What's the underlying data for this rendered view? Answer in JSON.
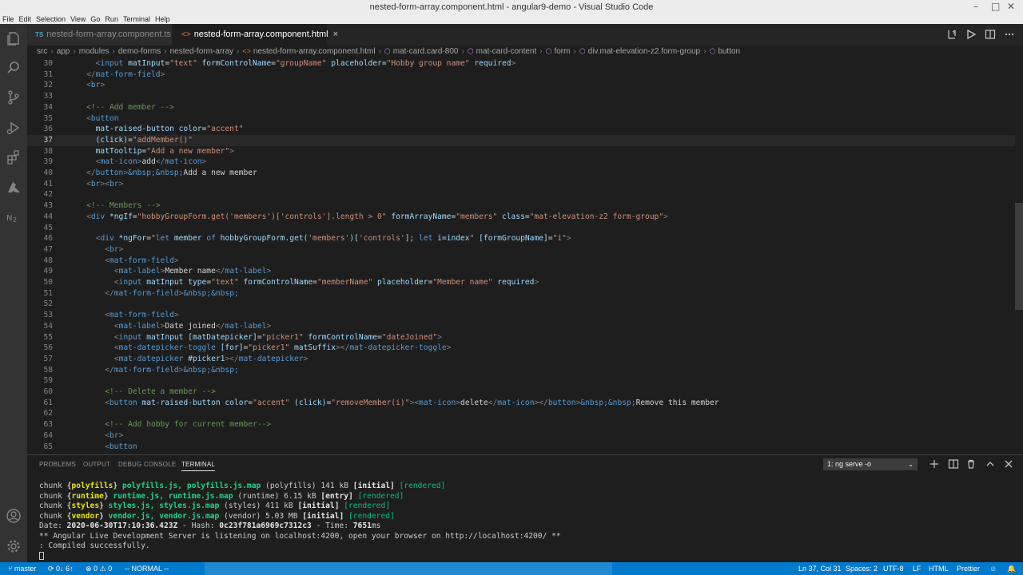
{
  "window": {
    "title": "nested-form-array.component.html - angular9-demo - Visual Studio Code"
  },
  "menu": [
    "File",
    "Edit",
    "Selection",
    "View",
    "Go",
    "Run",
    "Terminal",
    "Help"
  ],
  "tabs": [
    {
      "badge": "TS",
      "label": "nested-form-array.component.ts"
    },
    {
      "badge": "<>",
      "label": "nested-form-array.component.html",
      "close": "×"
    }
  ],
  "breadcrumb": [
    "src",
    "app",
    "modules",
    "demo-forms",
    "nested-form-array",
    "nested-form-array.component.html",
    "mat-card.card-800",
    "mat-card-content",
    "form",
    "div.mat-elevation-z2.form-group",
    "button"
  ],
  "editor": {
    "lines": [
      {
        "n": "30",
        "t": [
          [
            "      ",
            ""
          ],
          [
            "<",
            "tb"
          ],
          [
            "input",
            "tag"
          ],
          [
            " matInput",
            "attr"
          ],
          [
            "=",
            "txt"
          ],
          [
            "\"text\"",
            "str"
          ]
        ]
      },
      {
        "n": "31",
        "t": [
          [
            "    ",
            ""
          ],
          [
            "</",
            "tb"
          ],
          [
            "mat-form-field",
            "tag"
          ],
          [
            ">",
            "tb"
          ]
        ]
      },
      {
        "n": "32",
        "t": [
          [
            "    ",
            ""
          ],
          [
            "<",
            "tb"
          ],
          [
            "br",
            "tag"
          ],
          [
            ">",
            "tb"
          ]
        ]
      },
      {
        "n": "33",
        "t": []
      },
      {
        "n": "34",
        "t": [
          [
            "    ",
            ""
          ],
          [
            "<!-- Add member -->",
            "cmt"
          ]
        ]
      },
      {
        "n": "35",
        "t": [
          [
            "    ",
            ""
          ],
          [
            "<",
            "tb"
          ],
          [
            "button",
            "tag"
          ]
        ]
      },
      {
        "n": "36",
        "t": [
          [
            "      ",
            ""
          ],
          [
            "mat-raised-button",
            "attr"
          ],
          [
            " color",
            "attr"
          ],
          [
            "=",
            "txt"
          ],
          [
            "\"accent\"",
            "str"
          ]
        ]
      },
      {
        "n": "37",
        "t": [
          [
            "      ",
            ""
          ],
          [
            "(click)",
            "attr"
          ],
          [
            "=",
            "txt"
          ],
          [
            "\"addMember()\"",
            "str"
          ]
        ],
        "cur": true
      },
      {
        "n": "38",
        "t": [
          [
            "      ",
            ""
          ],
          [
            "matTooltip",
            "attr"
          ],
          [
            "=",
            "txt"
          ],
          [
            "\"Add a new member\"",
            "str"
          ],
          [
            ">",
            "tb"
          ]
        ]
      },
      {
        "n": "39",
        "t": [
          [
            "      ",
            ""
          ],
          [
            "<",
            "tb"
          ],
          [
            "mat-icon",
            "tag"
          ],
          [
            ">",
            "tb"
          ],
          [
            "add",
            "txt"
          ],
          [
            "</",
            "tb"
          ],
          [
            "mat-icon",
            "tag"
          ],
          [
            ">",
            "tb"
          ]
        ]
      },
      {
        "n": "40",
        "t": [
          [
            "    ",
            ""
          ],
          [
            "</",
            "tb"
          ],
          [
            "button",
            "tag"
          ],
          [
            ">",
            "tb"
          ],
          [
            "&nbsp;&nbsp;",
            "ent"
          ],
          [
            "Add a new member",
            "txt"
          ]
        ]
      },
      {
        "n": "41",
        "t": [
          [
            "    ",
            ""
          ],
          [
            "<",
            "tb"
          ],
          [
            "br",
            "tag"
          ],
          [
            "><",
            "tb"
          ],
          [
            "br",
            "tag"
          ],
          [
            ">",
            "tb"
          ]
        ]
      },
      {
        "n": "42",
        "t": []
      },
      {
        "n": "43",
        "t": [
          [
            "    ",
            ""
          ],
          [
            "<!-- Members -->",
            "cmt"
          ]
        ]
      },
      {
        "n": "44",
        "t": [
          [
            "    ",
            ""
          ],
          [
            "<",
            "tb"
          ],
          [
            "div",
            "tag"
          ],
          [
            " *ngIf",
            "attr"
          ],
          [
            "=",
            "txt"
          ],
          [
            "\"hobbyGroupForm.get('members')['controls'].length > 0\"",
            "str"
          ],
          [
            " formArrayName",
            "attr"
          ],
          [
            "=",
            "txt"
          ],
          [
            "\"members\"",
            "str"
          ],
          [
            " class",
            "attr"
          ],
          [
            "=",
            "txt"
          ],
          [
            "\"mat-elevation-z2 form-group\"",
            "str"
          ],
          [
            ">",
            "tb"
          ]
        ]
      },
      {
        "n": "45",
        "t": []
      },
      {
        "n": "46",
        "t": [
          [
            "      ",
            ""
          ],
          [
            "<",
            "tb"
          ],
          [
            "div",
            "tag"
          ],
          [
            " *ngFor",
            "attr"
          ],
          [
            "=",
            "txt"
          ],
          [
            "\"",
            "str"
          ],
          [
            "let",
            "kw"
          ],
          [
            " member ",
            "attr"
          ],
          [
            "of",
            "kw"
          ],
          [
            " hobbyGroupForm.get(",
            "attr"
          ],
          [
            "'members'",
            "str"
          ],
          [
            ")[",
            "attr"
          ],
          [
            "'controls'",
            "str"
          ],
          [
            "]; ",
            "attr"
          ],
          [
            "let",
            "kw"
          ],
          [
            " i=",
            "attr"
          ],
          [
            "index",
            "attr"
          ],
          [
            "\"",
            "str"
          ],
          [
            " [formGroupName]",
            "attr"
          ],
          [
            "=",
            "txt"
          ],
          [
            "\"i\"",
            "str"
          ],
          [
            ">",
            "tb"
          ]
        ]
      },
      {
        "n": "47",
        "t": [
          [
            "        ",
            ""
          ],
          [
            "<",
            "tb"
          ],
          [
            "br",
            "tag"
          ],
          [
            ">",
            "tb"
          ]
        ]
      },
      {
        "n": "48",
        "t": [
          [
            "        ",
            ""
          ],
          [
            "<",
            "tb"
          ],
          [
            "mat-form-field",
            "tag"
          ],
          [
            ">",
            "tb"
          ]
        ]
      },
      {
        "n": "49",
        "t": [
          [
            "          ",
            ""
          ],
          [
            "<",
            "tb"
          ],
          [
            "mat-label",
            "tag"
          ],
          [
            ">",
            "tb"
          ],
          [
            "Member name",
            "txt"
          ],
          [
            "</",
            "tb"
          ],
          [
            "mat-label",
            "tag"
          ],
          [
            ">",
            "tb"
          ]
        ]
      },
      {
        "n": "50",
        "t": [
          [
            "          ",
            ""
          ],
          [
            "<",
            "tb"
          ],
          [
            "input",
            "tag"
          ],
          [
            " matInput",
            "attr"
          ],
          [
            " type",
            "attr"
          ],
          [
            "=",
            "txt"
          ],
          [
            "\"text\"",
            "str"
          ],
          [
            " formControlName",
            "attr"
          ],
          [
            "=",
            "txt"
          ],
          [
            "\"memberName\"",
            "str"
          ],
          [
            " placeholder",
            "attr"
          ],
          [
            "=",
            "txt"
          ],
          [
            "\"Member name\"",
            "str"
          ],
          [
            " required",
            "attr"
          ],
          [
            ">",
            "tb"
          ]
        ]
      },
      {
        "n": "51",
        "t": [
          [
            "        ",
            ""
          ],
          [
            "</",
            "tb"
          ],
          [
            "mat-form-field",
            "tag"
          ],
          [
            ">",
            "tb"
          ],
          [
            "&nbsp;&nbsp;",
            "ent"
          ]
        ]
      },
      {
        "n": "52",
        "t": []
      },
      {
        "n": "53",
        "t": [
          [
            "        ",
            ""
          ],
          [
            "<",
            "tb"
          ],
          [
            "mat-form-field",
            "tag"
          ],
          [
            ">",
            "tb"
          ]
        ]
      },
      {
        "n": "54",
        "t": [
          [
            "          ",
            ""
          ],
          [
            "<",
            "tb"
          ],
          [
            "mat-label",
            "tag"
          ],
          [
            ">",
            "tb"
          ],
          [
            "Date joined",
            "txt"
          ],
          [
            "</",
            "tb"
          ],
          [
            "mat-label",
            "tag"
          ],
          [
            ">",
            "tb"
          ]
        ]
      },
      {
        "n": "55",
        "t": [
          [
            "          ",
            ""
          ],
          [
            "<",
            "tb"
          ],
          [
            "input",
            "tag"
          ],
          [
            " matInput",
            "attr"
          ],
          [
            " [matDatepicker]",
            "attr"
          ],
          [
            "=",
            "txt"
          ],
          [
            "\"picker1\"",
            "str"
          ],
          [
            " formControlName",
            "attr"
          ],
          [
            "=",
            "txt"
          ],
          [
            "\"dateJoined\"",
            "str"
          ],
          [
            ">",
            "tb"
          ]
        ]
      },
      {
        "n": "56",
        "t": [
          [
            "          ",
            ""
          ],
          [
            "<",
            "tb"
          ],
          [
            "mat-datepicker-toggle",
            "tag"
          ],
          [
            " [for]",
            "attr"
          ],
          [
            "=",
            "txt"
          ],
          [
            "\"picker1\"",
            "str"
          ],
          [
            " matSuffix",
            "attr"
          ],
          [
            "></",
            "tb"
          ],
          [
            "mat-datepicker-toggle",
            "tag"
          ],
          [
            ">",
            "tb"
          ]
        ]
      },
      {
        "n": "57",
        "t": [
          [
            "          ",
            ""
          ],
          [
            "<",
            "tb"
          ],
          [
            "mat-datepicker",
            "tag"
          ],
          [
            " #picker1",
            "attr"
          ],
          [
            "></",
            "tb"
          ],
          [
            "mat-datepicker",
            "tag"
          ],
          [
            ">",
            "tb"
          ]
        ]
      },
      {
        "n": "58",
        "t": [
          [
            "        ",
            ""
          ],
          [
            "</",
            "tb"
          ],
          [
            "mat-form-field",
            "tag"
          ],
          [
            ">",
            "tb"
          ],
          [
            "&nbsp;&nbsp;",
            "ent"
          ]
        ]
      },
      {
        "n": "59",
        "t": []
      },
      {
        "n": "60",
        "t": [
          [
            "        ",
            ""
          ],
          [
            "<!-- Delete a member -->",
            "cmt"
          ]
        ]
      },
      {
        "n": "61",
        "t": [
          [
            "        ",
            ""
          ],
          [
            "<",
            "tb"
          ],
          [
            "button",
            "tag"
          ],
          [
            " mat-raised-button",
            "attr"
          ],
          [
            " color",
            "attr"
          ],
          [
            "=",
            "txt"
          ],
          [
            "\"accent\"",
            "str"
          ],
          [
            " (click)",
            "attr"
          ],
          [
            "=",
            "txt"
          ],
          [
            "\"removeMember(i)\"",
            "str"
          ],
          [
            "><",
            "tb"
          ],
          [
            "mat-icon",
            "tag"
          ],
          [
            ">",
            "tb"
          ],
          [
            "delete",
            "txt"
          ],
          [
            "</",
            "tb"
          ],
          [
            "mat-icon",
            "tag"
          ],
          [
            "></",
            "tb"
          ],
          [
            "button",
            "tag"
          ],
          [
            ">",
            "tb"
          ],
          [
            "&nbsp;&nbsp;",
            "ent"
          ],
          [
            "Remove this member",
            "txt"
          ]
        ]
      },
      {
        "n": "62",
        "t": []
      },
      {
        "n": "63",
        "t": [
          [
            "        ",
            ""
          ],
          [
            "<!-- Add hobby for current member-->",
            "cmt"
          ]
        ]
      },
      {
        "n": "64",
        "t": [
          [
            "        ",
            ""
          ],
          [
            "<",
            "tb"
          ],
          [
            "br",
            "tag"
          ],
          [
            ">",
            "tb"
          ]
        ]
      },
      {
        "n": "65",
        "t": [
          [
            "        ",
            ""
          ],
          [
            "<",
            "tb"
          ],
          [
            "button",
            "tag"
          ]
        ]
      }
    ],
    "line30_extra": [
      [
        " formControlName",
        "attr"
      ],
      [
        "=",
        "txt"
      ],
      [
        "\"groupName\"",
        "str"
      ],
      [
        " placeholder",
        "attr"
      ],
      [
        "=",
        "txt"
      ],
      [
        "\"Hobby group name\"",
        "str"
      ],
      [
        " required",
        "attr"
      ],
      [
        ">",
        "tb"
      ]
    ]
  },
  "panel": {
    "tabs": [
      "PROBLEMS",
      "OUTPUT",
      "DEBUG CONSOLE",
      "TERMINAL"
    ],
    "active_tab": "TERMINAL",
    "terminal_select": "1: ng serve -o",
    "terminal_lines": [
      [
        [
          "chunk ",
          ""
        ],
        [
          "{",
          "m"
        ],
        [
          "polyfills",
          "y"
        ],
        [
          "} ",
          "m"
        ],
        [
          "polyfills.js, polyfills.js.map",
          "gb"
        ],
        [
          " (polyfills) 141 kB ",
          ""
        ],
        [
          "[initial]",
          "w"
        ],
        [
          " ",
          ""
        ],
        [
          "[rendered]",
          "g"
        ]
      ],
      [
        [
          "chunk ",
          ""
        ],
        [
          "{",
          "m"
        ],
        [
          "runtime",
          "y"
        ],
        [
          "} ",
          "m"
        ],
        [
          "runtime.js, runtime.js.map",
          "gb"
        ],
        [
          " (runtime) 6.15 kB ",
          ""
        ],
        [
          "[entry]",
          "w"
        ],
        [
          " ",
          ""
        ],
        [
          "[rendered]",
          "g"
        ]
      ],
      [
        [
          "chunk ",
          ""
        ],
        [
          "{",
          "m"
        ],
        [
          "styles",
          "y"
        ],
        [
          "} ",
          "m"
        ],
        [
          "styles.js, styles.js.map",
          "gb"
        ],
        [
          " (styles) 411 kB ",
          ""
        ],
        [
          "[initial]",
          "w"
        ],
        [
          " ",
          ""
        ],
        [
          "[rendered]",
          "g"
        ]
      ],
      [
        [
          "chunk ",
          ""
        ],
        [
          "{",
          "m"
        ],
        [
          "vendor",
          "y"
        ],
        [
          "} ",
          "m"
        ],
        [
          "vendor.js, vendor.js.map",
          "gb"
        ],
        [
          " (vendor) 5.03 MB ",
          ""
        ],
        [
          "[initial]",
          "w"
        ],
        [
          " ",
          ""
        ],
        [
          "[rendered]",
          "g"
        ]
      ],
      [
        [
          "Date: ",
          ""
        ],
        [
          "2020-06-30T17:10:36.423Z",
          "w"
        ],
        [
          " - Hash: ",
          ""
        ],
        [
          "0c23f781a6969c7312c3",
          "w"
        ],
        [
          " - Time: ",
          ""
        ],
        [
          "7651",
          "w"
        ],
        [
          "ms",
          ""
        ]
      ],
      [
        [
          "** Angular Live Development Server is listening on localhost:4200, open your browser on http://localhost:4200/ **",
          ""
        ]
      ],
      [
        [
          ": Compiled successfully.",
          ""
        ]
      ]
    ]
  },
  "status": {
    "branch": "master",
    "sync": "0↓ 6↑",
    "errors": "0",
    "warnings": "0",
    "mode": "-- NORMAL --",
    "position": "Ln 37, Col 31",
    "spaces": "Spaces: 2",
    "encoding": "UTF-8",
    "eol": "LF",
    "language": "HTML",
    "formatter": "Prettier"
  },
  "colors": {
    "statusbar": "#007acc",
    "editor_bg": "#1e1e1e",
    "activitybar": "#333333"
  }
}
